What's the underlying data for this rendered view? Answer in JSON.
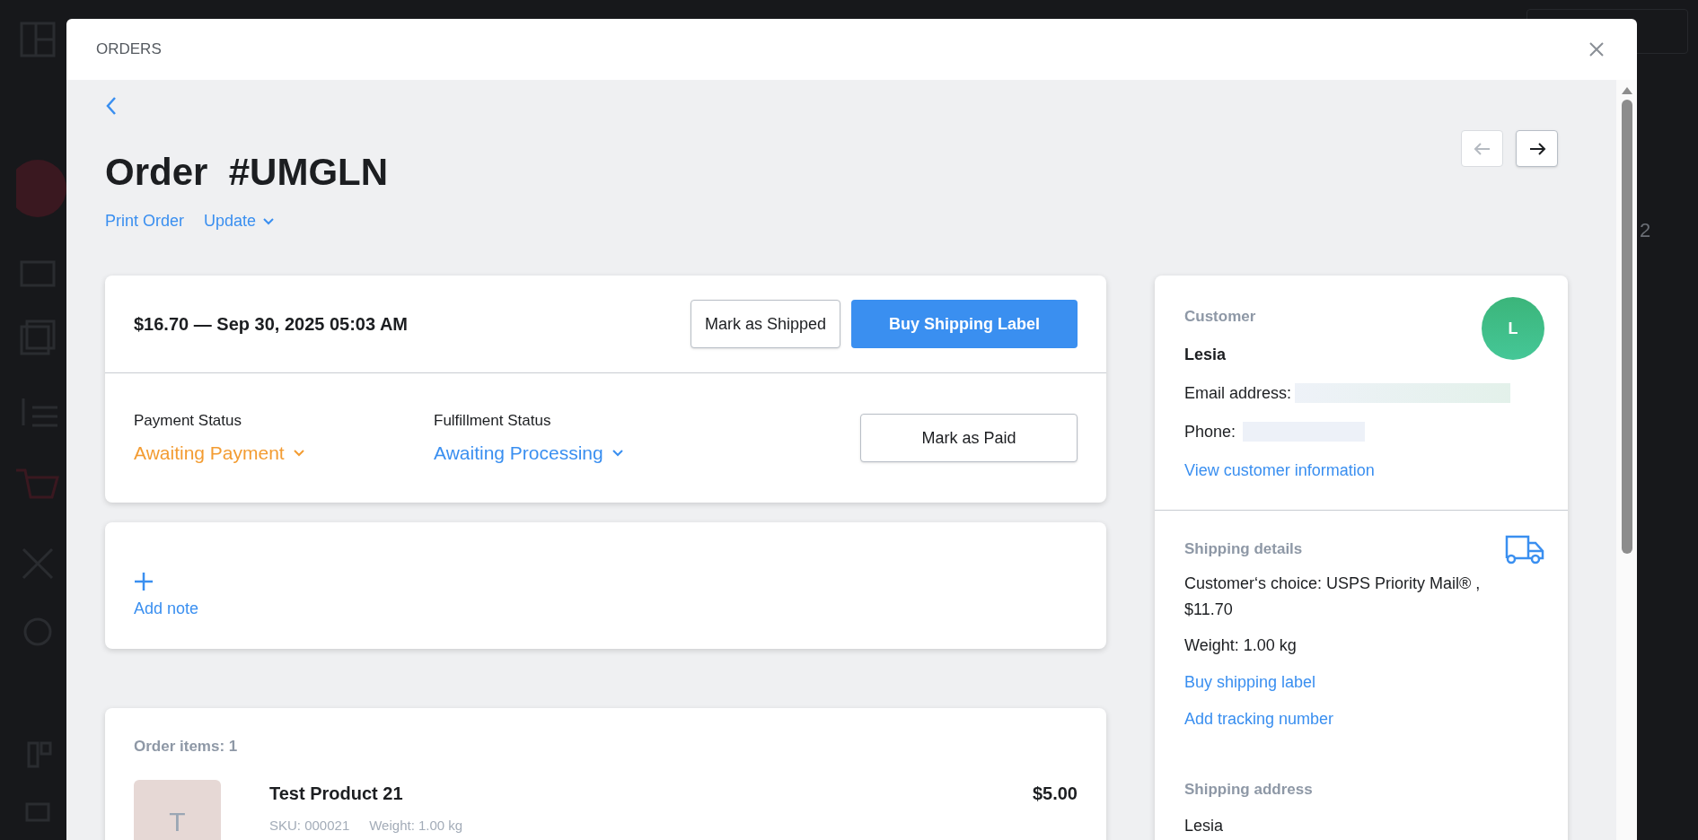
{
  "background": {
    "badge_text": "2"
  },
  "modal": {
    "title": "ORDERS"
  },
  "order": {
    "title": "Order  #UMGLN",
    "actions": [
      "Print Order",
      "Update"
    ],
    "nav": [
      {
        "kind": "prev",
        "disabled": true
      },
      {
        "kind": "next",
        "disabled": false
      }
    ]
  },
  "summary": {
    "heading": "$16.70 — Sep 30, 2025 05:03 AM",
    "buttons": [
      {
        "label": "Mark as Shipped",
        "primary": false
      },
      {
        "label": "Buy Shipping Label",
        "primary": true
      }
    ],
    "statuses": [
      {
        "label": "Payment Status",
        "value": "Awaiting Payment",
        "color": "#f39c32"
      },
      {
        "label": "Fulfillment Status",
        "value": "Awaiting Processing",
        "color": "#3a8ff0"
      }
    ],
    "side_button": "Mark as Paid"
  },
  "note": {
    "label": "Add note"
  },
  "items": {
    "heading": "Order items: 1",
    "rows": [
      {
        "initial": "T",
        "name": "Test Product 21",
        "price": "$5.00",
        "sku": "SKU: 000021",
        "weight": "Weight: 1.00 kg"
      }
    ]
  },
  "customer": {
    "heading": "Customer",
    "initial": "L",
    "name": "Lesia",
    "email_label": "Email address:",
    "phone_label": "Phone:",
    "link": "View customer information"
  },
  "shipping": {
    "heading": "Shipping details",
    "choice": "Customer‘s choice: USPS Priority Mail® , $11.70",
    "weight": "Weight: 1.00 kg",
    "links": [
      "Buy shipping label",
      "Add tracking number"
    ]
  },
  "address": {
    "heading": "Shipping address",
    "name": "Lesia"
  }
}
